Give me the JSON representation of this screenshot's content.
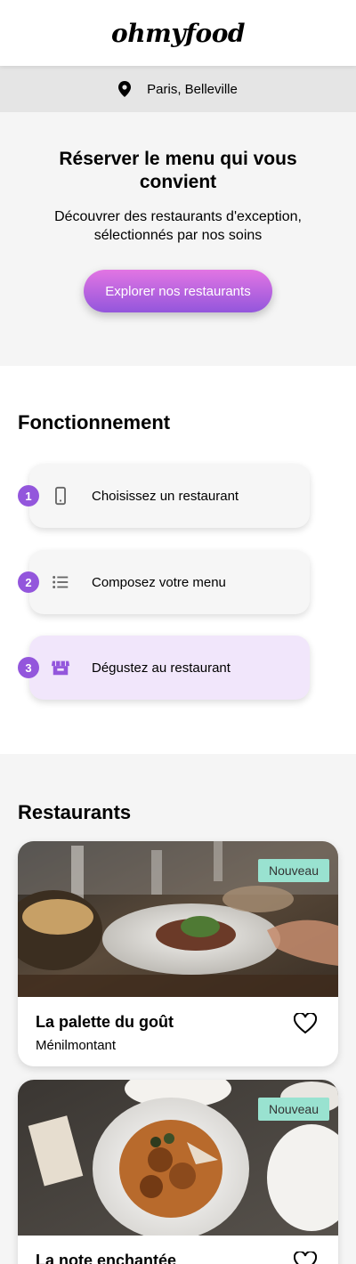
{
  "header": {
    "logo": "ohmyfood"
  },
  "location": {
    "icon": "map-pin-icon",
    "label": "Paris, Belleville"
  },
  "hero": {
    "title": "Réserver le menu qui vous convient",
    "subtitle": "Découvrer des restaurants d'exception, sélectionnés par nos soins",
    "cta_label": "Explorer nos restaurants"
  },
  "how": {
    "title": "Fonctionnement",
    "steps": [
      {
        "number": "1",
        "icon": "smartphone-icon",
        "label": "Choisissez un restaurant"
      },
      {
        "number": "2",
        "icon": "list-icon",
        "label": "Composez votre menu"
      },
      {
        "number": "3",
        "icon": "store-icon",
        "label": "Dégustez au restaurant"
      }
    ]
  },
  "restaurants": {
    "title": "Restaurants",
    "items": [
      {
        "name": "La palette du goût",
        "area": "Ménilmontant",
        "tag": "Nouveau",
        "photo": "restaurant-table-dish-photo"
      },
      {
        "name": "La note enchantée",
        "area": "",
        "tag": "Nouveau",
        "photo": "plated-meatballs-dish-photo"
      }
    ]
  },
  "colors": {
    "accent_purple": "#9356dc",
    "accent_pink": "#e275e3",
    "highlight_step": "#f1e6fb",
    "tag_green": "#99e2d0",
    "section_grey": "#f5f5f5",
    "location_bar": "#e5e5e5"
  }
}
